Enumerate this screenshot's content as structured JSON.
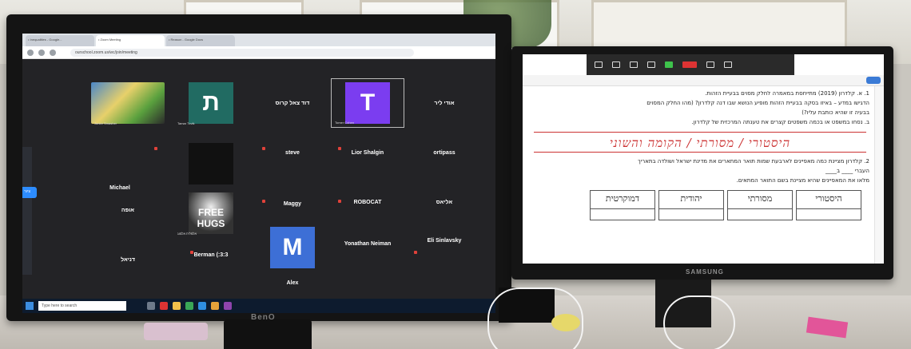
{
  "left_monitor": {
    "brand": "BenQ",
    "browser_tabs": [
      "• Inequalities - Google...",
      "• Zoom Meeting",
      "• Reason - Google Docs"
    ],
    "url": "ourschool.zoom.us/wc/join/meeting",
    "zoom": {
      "leave_label": "ציור",
      "participants": [
        {
          "name": "Junior Smasher",
          "kind": "video"
        },
        {
          "name": "ת",
          "caption": "Tamar Tzvik",
          "kind": "letter",
          "color": "#216b62"
        },
        {
          "name": "דוד צאל קרוס",
          "kind": "name"
        },
        {
          "name": "T",
          "caption": "Tomer Cohen",
          "kind": "letter",
          "color": "#7b3df0"
        },
        {
          "name": "אודי ליר",
          "kind": "name"
        },
        {
          "name": "steve",
          "kind": "name"
        },
        {
          "name": "Lior Shalgin",
          "kind": "name"
        },
        {
          "name": "ortipass",
          "kind": "name"
        },
        {
          "name": "Maggy",
          "kind": "name"
        },
        {
          "name": "ROBOCAT",
          "kind": "name"
        },
        {
          "name": "אליאס",
          "kind": "name"
        },
        {
          "name": "אופה",
          "kind": "name"
        },
        {
          "name": "FREE HUGS",
          "caption": "אלמליח אלמוג",
          "kind": "video"
        },
        {
          "name": "Yonathan Neiman",
          "kind": "name"
        },
        {
          "name": "Eli Sinlavsky",
          "kind": "name"
        },
        {
          "name": "דניאל",
          "kind": "name"
        },
        {
          "name": "Berman (:3:3",
          "kind": "name"
        },
        {
          "name": "M",
          "kind": "letter",
          "color": "#3d6fd6"
        },
        {
          "name": "Alex",
          "kind": "name"
        },
        {
          "name": "Michael",
          "kind": "name"
        }
      ]
    },
    "taskbar": {
      "search_placeholder": "Type here to search"
    }
  },
  "right_monitor": {
    "brand": "SAMSUNG",
    "document": {
      "q1_line1": "1. א. קלדרון (2019) מתייחסת במאמרה לחלק מסוים בבעיית הזהות.",
      "q1_line2": "הדגישו במדע – באיזו בסקה בבעיית הזהות מופיע הנושא שבו דנה קלדרון? (מהו החלק המסוים",
      "q1_line3": "בבעיה זו שהיא כותבת עליו?)",
      "q1_line4": "ב. נסחו במשפט או בכמה משפטים קצרים את טענתה המרכזית של קלדרון.",
      "handwriting": "היסטורי / מסורתי / הקומה והשוני",
      "q2_line1": "2. קלדרון מציינת כמה מאפיינים לארבעת שמות תואר המתארים את מדינת ישראל ושולדה בתאריך",
      "q2_line2": "העברי ____ ב____",
      "q2_line3": "מלאו את המאפיינים שהיא מציינת בשם התואר המתאים.",
      "table_headers": [
        "היסטורי",
        "מסורתי",
        "יהודית",
        "דמוקרטית"
      ]
    }
  }
}
